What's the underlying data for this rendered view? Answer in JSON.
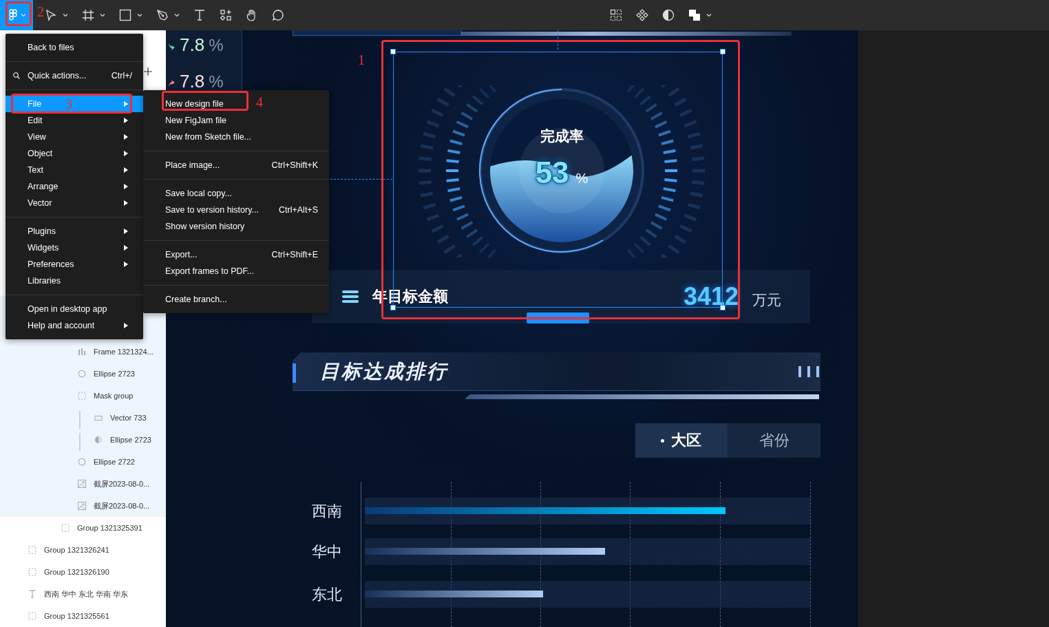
{
  "toolbar": {
    "menu_open": true
  },
  "main_menu": {
    "sections": [
      [
        {
          "label": "Back to files",
          "kind": "plain",
          "submenu": false,
          "selected": false
        }
      ],
      [
        {
          "label": "Quick actions...",
          "shortcut": "Ctrl+/",
          "kind": "search",
          "submenu": false,
          "selected": false
        }
      ],
      [
        {
          "label": "File",
          "kind": "plain",
          "submenu": true,
          "selected": true
        },
        {
          "label": "Edit",
          "kind": "plain",
          "submenu": true,
          "selected": false
        },
        {
          "label": "View",
          "kind": "plain",
          "submenu": true,
          "selected": false
        },
        {
          "label": "Object",
          "kind": "plain",
          "submenu": true,
          "selected": false
        },
        {
          "label": "Text",
          "kind": "plain",
          "submenu": true,
          "selected": false
        },
        {
          "label": "Arrange",
          "kind": "plain",
          "submenu": true,
          "selected": false
        },
        {
          "label": "Vector",
          "kind": "plain",
          "submenu": true,
          "selected": false
        }
      ],
      [
        {
          "label": "Plugins",
          "kind": "plain",
          "submenu": true,
          "selected": false
        },
        {
          "label": "Widgets",
          "kind": "plain",
          "submenu": true,
          "selected": false
        },
        {
          "label": "Preferences",
          "kind": "plain",
          "submenu": true,
          "selected": false
        },
        {
          "label": "Libraries",
          "kind": "plain",
          "submenu": false,
          "selected": false
        }
      ],
      [
        {
          "label": "Open in desktop app",
          "kind": "plain",
          "submenu": false,
          "selected": false
        },
        {
          "label": "Help and account",
          "kind": "plain",
          "submenu": true,
          "selected": false
        }
      ]
    ]
  },
  "submenu": {
    "sections": [
      [
        {
          "label": "New design file"
        },
        {
          "label": "New FigJam file"
        },
        {
          "label": "New from Sketch file..."
        }
      ],
      [
        {
          "label": "Place image...",
          "shortcut": "Ctrl+Shift+K"
        }
      ],
      [
        {
          "label": "Save local copy..."
        },
        {
          "label": "Save to version history...",
          "shortcut": "Ctrl+Alt+S"
        },
        {
          "label": "Show version history"
        }
      ],
      [
        {
          "label": "Export...",
          "shortcut": "Ctrl+Shift+E"
        },
        {
          "label": "Export frames to PDF..."
        }
      ],
      [
        {
          "label": "Create branch..."
        }
      ]
    ]
  },
  "layers": [
    {
      "children": [
        {
          "children": [
            {
              "children": [
                {
                  "name": "Frame 1321324...",
                  "kind": "frame",
                  "selected": true
                },
                {
                  "name": "Ellipse 2723",
                  "kind": "ellipse",
                  "selected": true
                },
                {
                  "name": "Mask group",
                  "kind": "group",
                  "selected": true,
                  "children": [
                    {
                      "name": "Vector 733",
                      "kind": "vector",
                      "selected": true
                    },
                    {
                      "name": "Ellipse 2723",
                      "kind": "mask",
                      "selected": true
                    }
                  ]
                },
                {
                  "name": "Ellipse 2722",
                  "kind": "ellipse",
                  "selected": true
                },
                {
                  "name": "截屏2023-08-0...",
                  "kind": "image",
                  "selected": true
                },
                {
                  "name": "截屏2023-08-0...",
                  "kind": "image",
                  "selected": true
                }
              ]
            },
            {
              "name": "Group 1321325391",
              "kind": "group",
              "selected": false
            }
          ]
        }
      ]
    },
    {
      "name": "Group 1321326241",
      "kind": "group",
      "selected": false
    },
    {
      "name": "Group 1321326190",
      "kind": "group",
      "selected": false
    },
    {
      "name": "西南 华中 东北 华南 华东",
      "kind": "text",
      "selected": false
    },
    {
      "name": "Group 1321325561",
      "kind": "group",
      "selected": false
    }
  ],
  "canvas": {
    "stats": [
      {
        "value": "7.8",
        "unit": "%",
        "kind": "down"
      },
      {
        "value": "7.8",
        "unit": "%",
        "kind": "up"
      }
    ],
    "gauge": {
      "title": "完成率",
      "value": "53",
      "unit": "%",
      "level": 0.53
    },
    "target": {
      "label": "年目标金额",
      "value": "3412",
      "unit": "万元"
    },
    "ranking": {
      "title": "目标达成排行",
      "tabs": [
        {
          "label": "大区",
          "selected": true
        },
        {
          "label": "省份",
          "selected": false
        }
      ],
      "rows": [
        {
          "label": "西南",
          "level": 0.81
        },
        {
          "label": "华中",
          "level": 0.54
        },
        {
          "label": "东北",
          "level": 0.4
        }
      ]
    }
  },
  "annotations": [
    {
      "label": "1"
    },
    {
      "label": "2"
    },
    {
      "label": "3"
    },
    {
      "label": "4"
    }
  ]
}
